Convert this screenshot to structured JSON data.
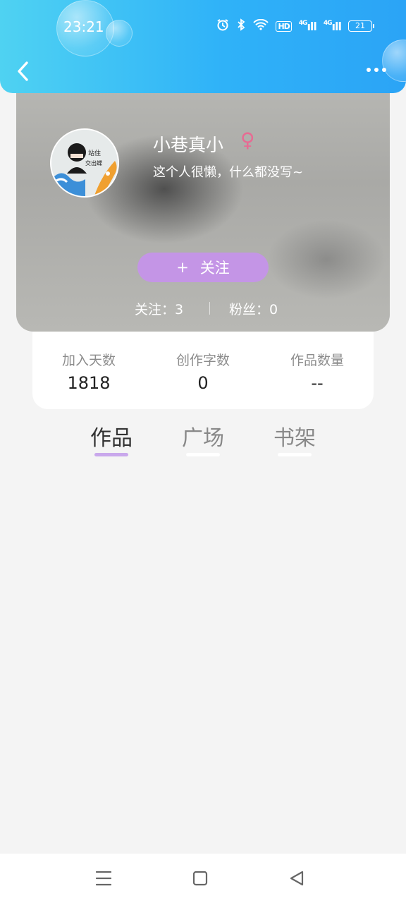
{
  "status_bar": {
    "time": "23:21",
    "hd_label": "HD",
    "signal1_label": "4G",
    "signal2_label": "4G",
    "battery": "21"
  },
  "header": {
    "back_icon": "chevron-left-icon",
    "more_icon": "more-horizontal-icon"
  },
  "profile": {
    "name": "小巷真小",
    "gender_symbol": "♀",
    "bio": "这个人很懒，什么都没写~",
    "follow_button": "关注",
    "follow_plus": "+",
    "following": "关注：3",
    "fans": "粉丝：0",
    "avatar_caption_line1": "站住",
    "avatar_caption_line2": "交出蝶",
    "colors": {
      "header_start": "#4fd2f2",
      "header_end": "#2ba4f6",
      "follow_button": "#c495e6",
      "gender": "#e76b93"
    }
  },
  "stats": {
    "join_days_label": "加入天数",
    "join_days_value": "1818",
    "words_label": "创作字数",
    "words_value": "0",
    "works_count_label": "作品数量",
    "works_count_value": "--"
  },
  "tabs": [
    {
      "label": "作品",
      "active": true
    },
    {
      "label": "广场",
      "active": false
    },
    {
      "label": "书架",
      "active": false
    }
  ],
  "nav": {
    "menu_icon": "menu-icon",
    "home_icon": "square-home-icon",
    "back_icon": "triangle-back-icon"
  }
}
